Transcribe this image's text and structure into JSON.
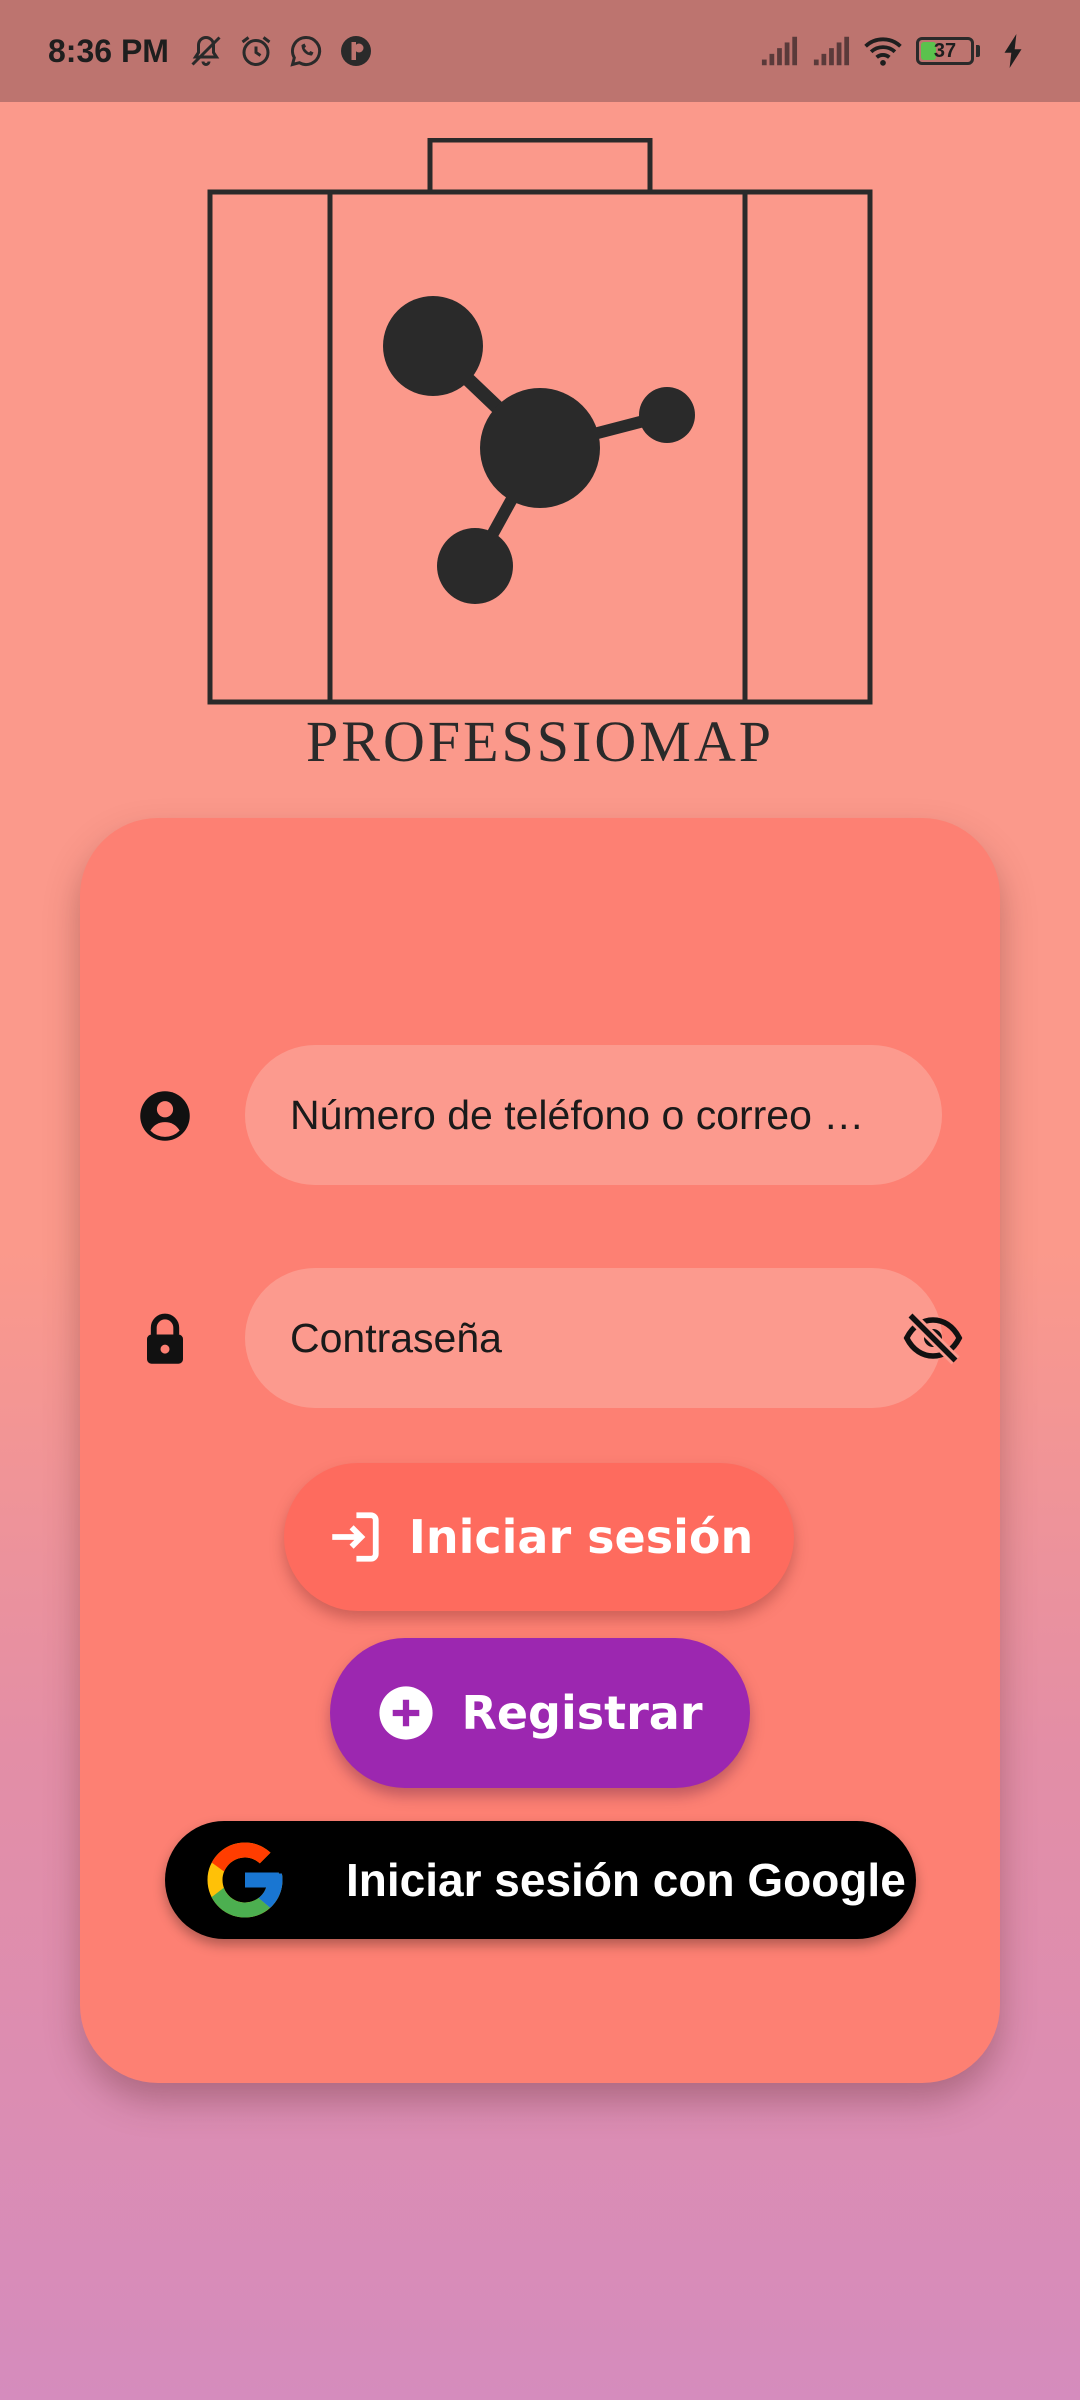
{
  "status_bar": {
    "time": "8:36 PM",
    "battery_level": "37",
    "battery_fraction": 0.37,
    "left_icons": [
      "mute-icon",
      "alarm-icon",
      "whatsapp-icon",
      "app-icon"
    ],
    "right_icons": [
      "signal-icon",
      "signal-icon",
      "wifi-icon",
      "battery-icon",
      "charging-icon"
    ]
  },
  "brand": {
    "name": "PROFESSIOMAP"
  },
  "login_form": {
    "username_placeholder": "Número de teléfono o correo …",
    "password_placeholder": "Contraseña",
    "user_icon": "account-circle-icon",
    "lock_icon": "lock-icon",
    "visibility_icon": "visibility-off-icon"
  },
  "actions": {
    "login_label": "Iniciar sesión",
    "register_label": "Registrar",
    "google_label": "Iniciar sesión con Google"
  },
  "colors": {
    "background_top": "#fb998b",
    "background_bottom": "#d58cbd",
    "card": "#fd8073",
    "field": "#fc9a8e",
    "login_button": "#fe6b5e",
    "register_button": "#9c27b0",
    "google_button": "#000000"
  }
}
